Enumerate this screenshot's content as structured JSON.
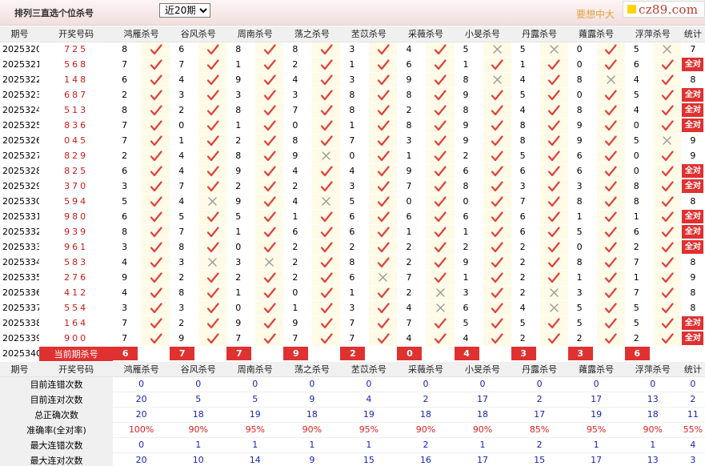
{
  "header": {
    "title": "排列三直选个位杀号",
    "period_select": "近20期",
    "slogan": "要想中大",
    "logo_text": "cz89.com"
  },
  "columns": {
    "issue": "期号",
    "number": "开奖号码",
    "experts": [
      "鸿雁杀号",
      "谷风杀号",
      "周南杀号",
      "荡之杀号",
      "苤苡杀号",
      "采薇杀号",
      "小旻杀号",
      "丹露杀号",
      "蕹露杀号",
      "浮萍杀号"
    ],
    "stat": "统计"
  },
  "rows": [
    {
      "issue": "2025320",
      "number": "725",
      "kills": [
        8,
        6,
        8,
        8,
        3,
        4,
        5,
        5,
        0,
        5
      ],
      "marks": [
        1,
        1,
        1,
        1,
        1,
        1,
        0,
        0,
        1,
        0
      ],
      "stat": "7"
    },
    {
      "issue": "2025321",
      "number": "568",
      "kills": [
        7,
        7,
        1,
        2,
        1,
        6,
        1,
        1,
        0,
        6
      ],
      "marks": [
        1,
        1,
        1,
        1,
        1,
        1,
        1,
        1,
        1,
        1
      ],
      "stat": "全对"
    },
    {
      "issue": "2025322",
      "number": "148",
      "kills": [
        6,
        4,
        9,
        4,
        3,
        9,
        8,
        4,
        8,
        4
      ],
      "marks": [
        1,
        1,
        1,
        1,
        1,
        1,
        0,
        1,
        0,
        1
      ],
      "stat": "8"
    },
    {
      "issue": "2025323",
      "number": "687",
      "kills": [
        2,
        3,
        3,
        3,
        8,
        8,
        9,
        5,
        0,
        5
      ],
      "marks": [
        1,
        1,
        1,
        1,
        1,
        1,
        1,
        1,
        1,
        1
      ],
      "stat": "全对"
    },
    {
      "issue": "2025324",
      "number": "513",
      "kills": [
        8,
        2,
        8,
        7,
        8,
        2,
        8,
        4,
        8,
        4
      ],
      "marks": [
        1,
        1,
        1,
        1,
        1,
        1,
        1,
        1,
        1,
        1
      ],
      "stat": "全对"
    },
    {
      "issue": "2025325",
      "number": "836",
      "kills": [
        7,
        0,
        1,
        0,
        1,
        8,
        9,
        8,
        9,
        0
      ],
      "marks": [
        1,
        1,
        1,
        1,
        1,
        1,
        1,
        1,
        1,
        1
      ],
      "stat": "全对"
    },
    {
      "issue": "2025326",
      "number": "045",
      "kills": [
        7,
        1,
        2,
        8,
        7,
        3,
        9,
        8,
        9,
        5
      ],
      "marks": [
        1,
        1,
        1,
        1,
        1,
        1,
        1,
        1,
        1,
        0
      ],
      "stat": "9"
    },
    {
      "issue": "2025327",
      "number": "829",
      "kills": [
        2,
        4,
        8,
        9,
        0,
        1,
        2,
        5,
        6,
        0
      ],
      "marks": [
        1,
        1,
        1,
        0,
        1,
        1,
        1,
        1,
        1,
        1
      ],
      "stat": "9"
    },
    {
      "issue": "2025328",
      "number": "825",
      "kills": [
        6,
        4,
        9,
        4,
        4,
        9,
        6,
        6,
        6,
        0
      ],
      "marks": [
        1,
        1,
        1,
        1,
        1,
        1,
        1,
        1,
        1,
        1
      ],
      "stat": "全对"
    },
    {
      "issue": "2025329",
      "number": "370",
      "kills": [
        3,
        7,
        2,
        2,
        3,
        7,
        8,
        3,
        3,
        8
      ],
      "marks": [
        1,
        1,
        1,
        1,
        1,
        1,
        1,
        1,
        1,
        1
      ],
      "stat": "全对"
    },
    {
      "issue": "2025330",
      "number": "594",
      "kills": [
        5,
        4,
        9,
        4,
        5,
        0,
        0,
        7,
        8,
        8
      ],
      "marks": [
        1,
        0,
        1,
        0,
        1,
        1,
        1,
        1,
        1,
        1
      ],
      "stat": "8"
    },
    {
      "issue": "2025331",
      "number": "980",
      "kills": [
        6,
        5,
        5,
        1,
        6,
        6,
        6,
        6,
        1,
        1
      ],
      "marks": [
        1,
        1,
        1,
        1,
        1,
        1,
        1,
        1,
        1,
        1
      ],
      "stat": "全对"
    },
    {
      "issue": "2025332",
      "number": "939",
      "kills": [
        8,
        7,
        1,
        6,
        6,
        1,
        1,
        6,
        5,
        6
      ],
      "marks": [
        1,
        1,
        1,
        1,
        1,
        1,
        1,
        1,
        1,
        1
      ],
      "stat": "全对"
    },
    {
      "issue": "2025333",
      "number": "961",
      "kills": [
        3,
        8,
        0,
        2,
        2,
        2,
        2,
        2,
        0,
        2
      ],
      "marks": [
        1,
        1,
        1,
        1,
        1,
        1,
        1,
        1,
        1,
        1
      ],
      "stat": "全对"
    },
    {
      "issue": "2025334",
      "number": "583",
      "kills": [
        4,
        3,
        3,
        2,
        8,
        2,
        9,
        2,
        8,
        7
      ],
      "marks": [
        1,
        0,
        0,
        1,
        1,
        1,
        1,
        1,
        1,
        1
      ],
      "stat": "8"
    },
    {
      "issue": "2025335",
      "number": "276",
      "kills": [
        9,
        2,
        2,
        2,
        6,
        7,
        1,
        2,
        1,
        1
      ],
      "marks": [
        1,
        1,
        1,
        1,
        0,
        1,
        1,
        1,
        1,
        1
      ],
      "stat": "9"
    },
    {
      "issue": "2025336",
      "number": "412",
      "kills": [
        4,
        8,
        1,
        0,
        1,
        2,
        3,
        2,
        3,
        7
      ],
      "marks": [
        1,
        1,
        1,
        1,
        1,
        0,
        1,
        0,
        1,
        1
      ],
      "stat": "8"
    },
    {
      "issue": "2025337",
      "number": "554",
      "kills": [
        3,
        3,
        0,
        1,
        3,
        4,
        6,
        4,
        5,
        5
      ],
      "marks": [
        1,
        1,
        1,
        1,
        1,
        0,
        1,
        0,
        1,
        1
      ],
      "stat": "8"
    },
    {
      "issue": "2025338",
      "number": "164",
      "kills": [
        7,
        2,
        9,
        9,
        7,
        7,
        5,
        5,
        5,
        5
      ],
      "marks": [
        1,
        1,
        1,
        1,
        1,
        1,
        1,
        1,
        1,
        1
      ],
      "stat": "全对"
    },
    {
      "issue": "2025339",
      "number": "900",
      "kills": [
        7,
        9,
        7,
        7,
        7,
        4,
        4,
        2,
        2,
        2
      ],
      "marks": [
        1,
        1,
        1,
        1,
        1,
        1,
        1,
        1,
        1,
        1
      ],
      "stat": "全对"
    }
  ],
  "current": {
    "issue": "2025340",
    "label": "当前期杀号",
    "kills": [
      "6",
      "7",
      "7",
      "9",
      "2",
      "0",
      "4",
      "3",
      "3",
      "6"
    ]
  },
  "summary": [
    {
      "label": "目前连错次数",
      "values": [
        "0",
        "0",
        "0",
        "0",
        "0",
        "0",
        "0",
        "0",
        "0",
        "0",
        "0"
      ],
      "red": false
    },
    {
      "label": "目前连对次数",
      "values": [
        "20",
        "5",
        "5",
        "9",
        "4",
        "2",
        "17",
        "2",
        "17",
        "13",
        "2"
      ],
      "red": false
    },
    {
      "label": "总正确次数",
      "values": [
        "20",
        "18",
        "19",
        "18",
        "19",
        "18",
        "18",
        "17",
        "19",
        "18",
        "11"
      ],
      "red": false
    },
    {
      "label": "准确率(全对率)",
      "values": [
        "100%",
        "90%",
        "95%",
        "90%",
        "95%",
        "90%",
        "90%",
        "85%",
        "95%",
        "90%",
        "55%"
      ],
      "red": true
    },
    {
      "label": "最大连错次数",
      "values": [
        "0",
        "1",
        "1",
        "1",
        "1",
        "2",
        "1",
        "2",
        "1",
        "1",
        "4"
      ],
      "red": false
    },
    {
      "label": "最大连对次数",
      "values": [
        "20",
        "10",
        "14",
        "9",
        "15",
        "16",
        "17",
        "15",
        "17",
        "13",
        "3"
      ],
      "red": false
    }
  ]
}
